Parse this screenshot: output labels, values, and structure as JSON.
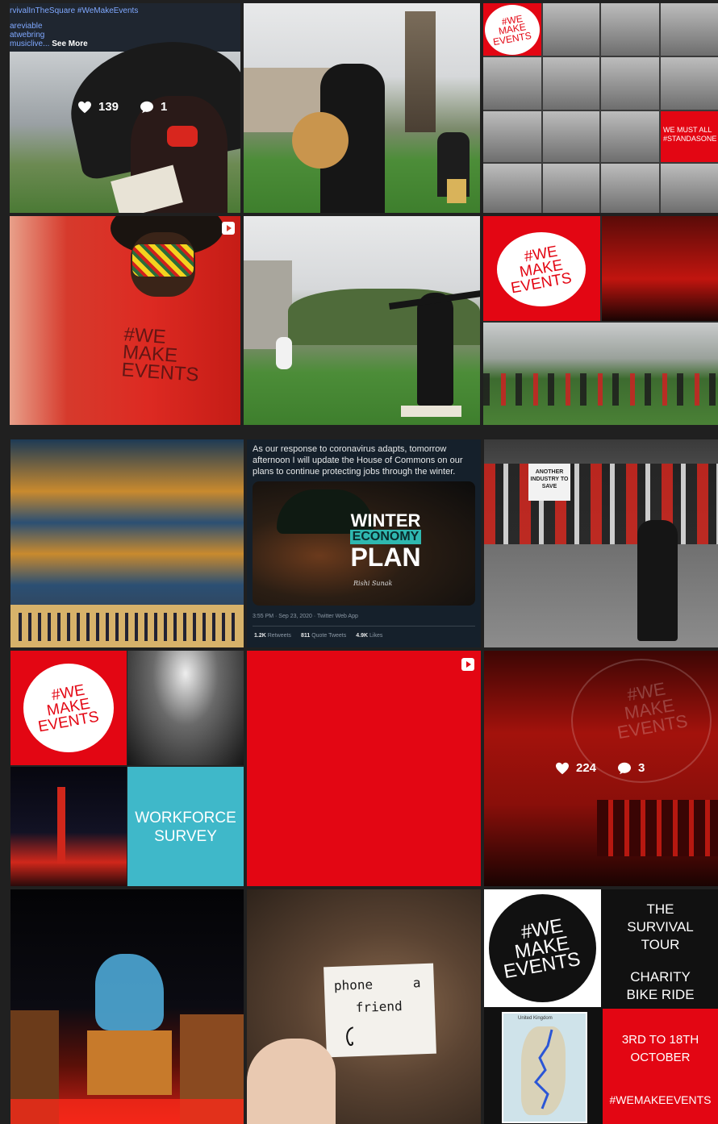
{
  "caption": {
    "line1": "rvivalInTheSquare #WeMakeEvents",
    "line2": "areviable",
    "line3": "atwebring",
    "line4": "musiclive...",
    "see_more": "See More"
  },
  "top_left_stats": {
    "likes": "139",
    "comments": "1"
  },
  "red_alert_stats": {
    "likes": "224",
    "comments": "3"
  },
  "brand": {
    "we": "#WE",
    "make": "MAKE",
    "events": "EVENTS",
    "red": "#e30613",
    "teal": "#3fb8c9"
  },
  "collage1": {
    "banner": "WE MUST ALL #STANDASONE"
  },
  "tweet": {
    "text": "As our response to coronavirus adapts, tomorrow afternoon I will update the House of Commons on our plans to continue protecting jobs through the winter.",
    "image_line1": "WINTER",
    "image_line2": "ECONOMY",
    "image_line3": "PLAN",
    "signature": "Rishi Sunak",
    "meta": "3:55 PM · Sep 23, 2020 · Twitter Web App",
    "retweets": "1.2K",
    "retweets_label": "Retweets",
    "quotes": "811",
    "quotes_label": "Quote Tweets",
    "likes": "4.9K",
    "likes_label": "Likes"
  },
  "survey": {
    "title": "WORKFORCE",
    "subtitle": "SURVEY"
  },
  "protest": {
    "sign": "ANOTHER INDUSTRY TO SAVE"
  },
  "note": {
    "line1": "phone",
    "line2": "a",
    "line3": "friend"
  },
  "tour": {
    "title": "THE SURVIVAL TOUR",
    "subtitle": "CHARITY BIKE RIDE",
    "dates": "3RD TO 18TH OCTOBER",
    "hashtag": "#WEMAKEEVENTS",
    "map_label": "United Kingdom"
  }
}
